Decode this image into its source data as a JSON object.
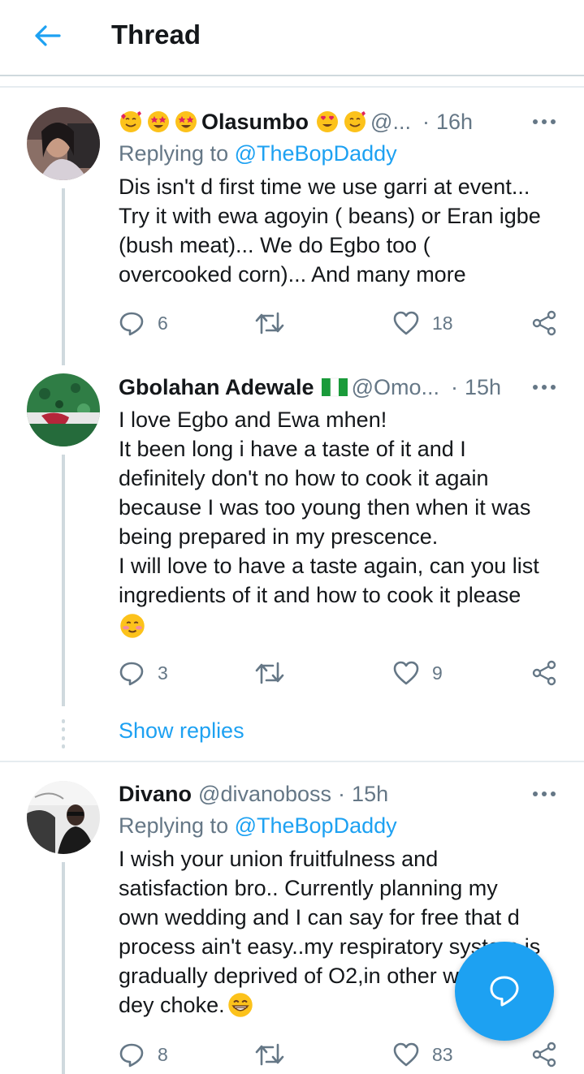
{
  "header": {
    "title": "Thread"
  },
  "tweets": [
    {
      "name": "Olasumbo",
      "handle": "@...",
      "time": "16h",
      "reply_prefix": "Replying to ",
      "reply_to": "@TheBopDaddy",
      "lines": [
        "Dis isn't d first time we use garri at event...",
        "Try it with ewa agoyin ( beans) or Eran igbe",
        "(bush meat)... We do Egbo too (",
        "overcooked corn)... And many more"
      ],
      "replies": "6",
      "likes": "18"
    },
    {
      "name": "Gbolahan Adewale",
      "handle": "@Omo...",
      "time": "15h",
      "lines": [
        "I love Egbo and Ewa mhen!",
        "It been long i have a taste of it and I",
        "definitely don't no how to cook it again",
        "because I was too young then when it was",
        "being prepared in my prescence.",
        "I will love to have a taste again, can you list",
        "ingredients of it and how to cook it please"
      ],
      "replies": "3",
      "likes": "9"
    },
    {
      "name": "Divano",
      "handle": "@divanoboss",
      "time": "15h",
      "reply_prefix": "Replying to ",
      "reply_to": "@TheBopDaddy",
      "lines": [
        "I wish your union fruitfulness and",
        "satisfaction bro.. Currently planning my",
        "own wedding and I can say for free that d",
        "process ain't easy..my respiratory system is",
        "gradually deprived of O2,in other words",
        "dey choke."
      ],
      "replies": "8",
      "likes": "83"
    }
  ],
  "show_replies": "Show replies",
  "separator": "·",
  "icons": {
    "back": "arrow-left-icon",
    "more": "more-icon",
    "reply": "reply-icon",
    "retweet": "retweet-icon",
    "like": "heart-icon",
    "share": "share-icon",
    "compose": "compose-reply-icon"
  },
  "colors": {
    "accent": "#1da1f2",
    "text": "#14171a",
    "secondary": "#657786",
    "border": "#cfd9de"
  }
}
